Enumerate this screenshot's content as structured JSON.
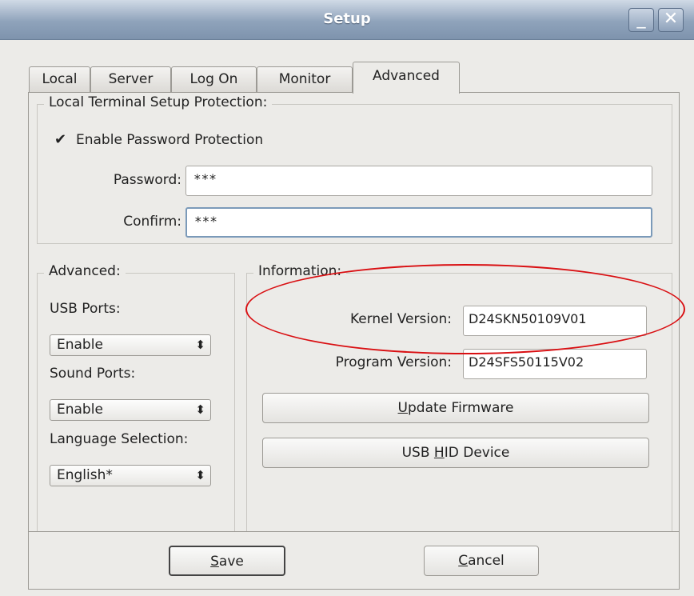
{
  "window": {
    "title": "Setup",
    "minimize_glyph": "_",
    "close_glyph": "✕"
  },
  "tabs": [
    {
      "label": "Local"
    },
    {
      "label": "Server"
    },
    {
      "label": "Log On"
    },
    {
      "label": "Monitor"
    },
    {
      "label": "Advanced",
      "active": true
    }
  ],
  "local_protection": {
    "group_title": "Local Terminal Setup Protection:",
    "enable_checkbox": {
      "label": "Enable Password Protection",
      "checked": true,
      "glyph": "✔"
    },
    "password_label": "Password:",
    "password_value": "***",
    "confirm_label": "Confirm:",
    "confirm_value": "***"
  },
  "advanced": {
    "group_title": "Advanced:",
    "usb_ports_label": "USB Ports:",
    "usb_ports_value": "Enable",
    "sound_ports_label": "Sound Ports:",
    "sound_ports_value": "Enable",
    "language_label": "Language Selection:",
    "language_value": "English*",
    "select_arrow_glyph": "⬍"
  },
  "information": {
    "group_title": "Information:",
    "kernel_version_label": "Kernel Version:",
    "kernel_version_value": "D24SKN50109V01",
    "program_version_label": "Program Version:",
    "program_version_value": "D24SFS50115V02",
    "update_firmware": {
      "before": "",
      "underlined": "U",
      "after": "pdate Firmware"
    },
    "usb_hid_device": {
      "before": "USB ",
      "underlined": "H",
      "after": "ID Device"
    }
  },
  "footer": {
    "save": {
      "before": "",
      "underlined": "S",
      "after": "ave"
    },
    "cancel": {
      "before": "",
      "underlined": "C",
      "after": "ancel"
    }
  },
  "colors": {
    "annotation_circle": "#d90f12",
    "title_bar": "#8fa3bb"
  }
}
